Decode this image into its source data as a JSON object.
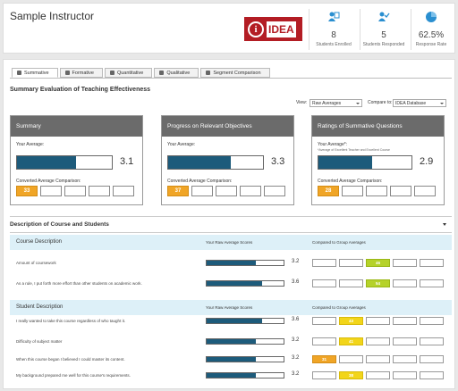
{
  "header": {
    "instructor": "Sample Instructor",
    "logo_text": "IDEA",
    "stats": [
      {
        "icon": "students-enrolled-icon",
        "value": "8",
        "label": "Students Enrolled"
      },
      {
        "icon": "students-responded-icon",
        "value": "5",
        "label": "Students Responded"
      },
      {
        "icon": "pie-chart-icon",
        "value": "62.5%",
        "label": "Response Rate"
      }
    ]
  },
  "tabs": [
    "Summative",
    "Formative",
    "Quantitative",
    "Qualitative",
    "Segment Comparison"
  ],
  "section_title": "Summary Evaluation of Teaching Effectiveness",
  "controls": {
    "view_label": "View:",
    "view_value": "Raw Averages",
    "compare_label": "Compare to:",
    "compare_value": "IDEA Database"
  },
  "cards": [
    {
      "title": "Summary",
      "your_avg": "Your Average:",
      "note": "",
      "value": "3.1",
      "fill": 0.62,
      "cac_label": "Converted Average Comparison:",
      "comparison": "33",
      "highlight": 0
    },
    {
      "title": "Progress on Relevant Objectives",
      "your_avg": "Your Average:",
      "note": "",
      "value": "3.3",
      "fill": 0.66,
      "cac_label": "Converted Average Comparison:",
      "comparison": "37",
      "highlight": 0
    },
    {
      "title": "Ratings of Summative Questions",
      "your_avg": "Your Average*:",
      "note": "*Average of Excellent Teacher and Excellent Course",
      "value": "2.9",
      "fill": 0.58,
      "cac_label": "Converted Average Comparison:",
      "comparison": "28",
      "highlight": 0
    }
  ],
  "description": {
    "title": "Description of Course and Students",
    "groups": [
      {
        "title": "Course Description",
        "col1": "Your Raw Average Scores",
        "col2": "Compared to Group Averages",
        "rows": [
          {
            "label": "Amount of coursework",
            "value": "3.2",
            "fill": 0.64,
            "score": "46",
            "box": 2,
            "color": "green"
          },
          {
            "label": "As a rule, I put forth more effort than other students on academic work.",
            "value": "3.6",
            "fill": 0.72,
            "score": "54",
            "box": 2,
            "color": "green"
          }
        ]
      },
      {
        "title": "Student Description",
        "col1": "Your Raw Average Scores",
        "col2": "Compared to Group Averages",
        "rows": [
          {
            "label": "I really wanted to take this course regardless of who taught it.",
            "value": "3.6",
            "fill": 0.72,
            "score": "43",
            "box": 1,
            "color": "yellow"
          },
          {
            "label": "Difficulty of subject matter",
            "value": "3.2",
            "fill": 0.64,
            "score": "41",
            "box": 1,
            "color": "yellow"
          },
          {
            "label": "When this course began I believed I could master its content.",
            "value": "3.2",
            "fill": 0.64,
            "score": "31",
            "box": 0,
            "color": "orange"
          },
          {
            "label": "My background prepared me well for this course's requirements.",
            "value": "3.2",
            "fill": 0.64,
            "score": "38",
            "box": 1,
            "color": "yellow"
          }
        ]
      }
    ]
  },
  "colors": {
    "bar": "#1d5b7b",
    "card_header": "#6b6b6b",
    "group_bg": "#ddf0f8",
    "highlight_orange": "#f0a526",
    "highlight_green": "#b5d22a",
    "highlight_yellow": "#f2d51a",
    "logo_red": "#b31d24"
  }
}
